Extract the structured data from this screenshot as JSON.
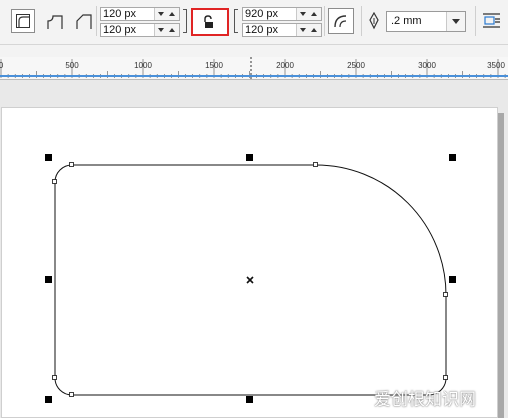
{
  "toolbar": {
    "corner_tools": [
      "round-corner-icon",
      "scalloped-corner-icon",
      "chamfered-corner-icon"
    ],
    "corner_radius": {
      "top_left": "120 px",
      "bottom_left": "120 px",
      "top_right": "920 px",
      "bottom_right": "120 px"
    },
    "lock_state": "unlocked",
    "outline_width": ".2 mm"
  },
  "ruler": {
    "labels": [
      "0",
      "500",
      "1000",
      "1500",
      "2000",
      "2500",
      "3000",
      "3500"
    ],
    "unit_note": ""
  },
  "watermark": "爱创根知识网",
  "colors": {
    "highlight": "#e02424",
    "ruler_accent": "#4a90d9",
    "toolbar_bg": "#f3f3f3",
    "workspace_bg": "#e9e9e9"
  }
}
